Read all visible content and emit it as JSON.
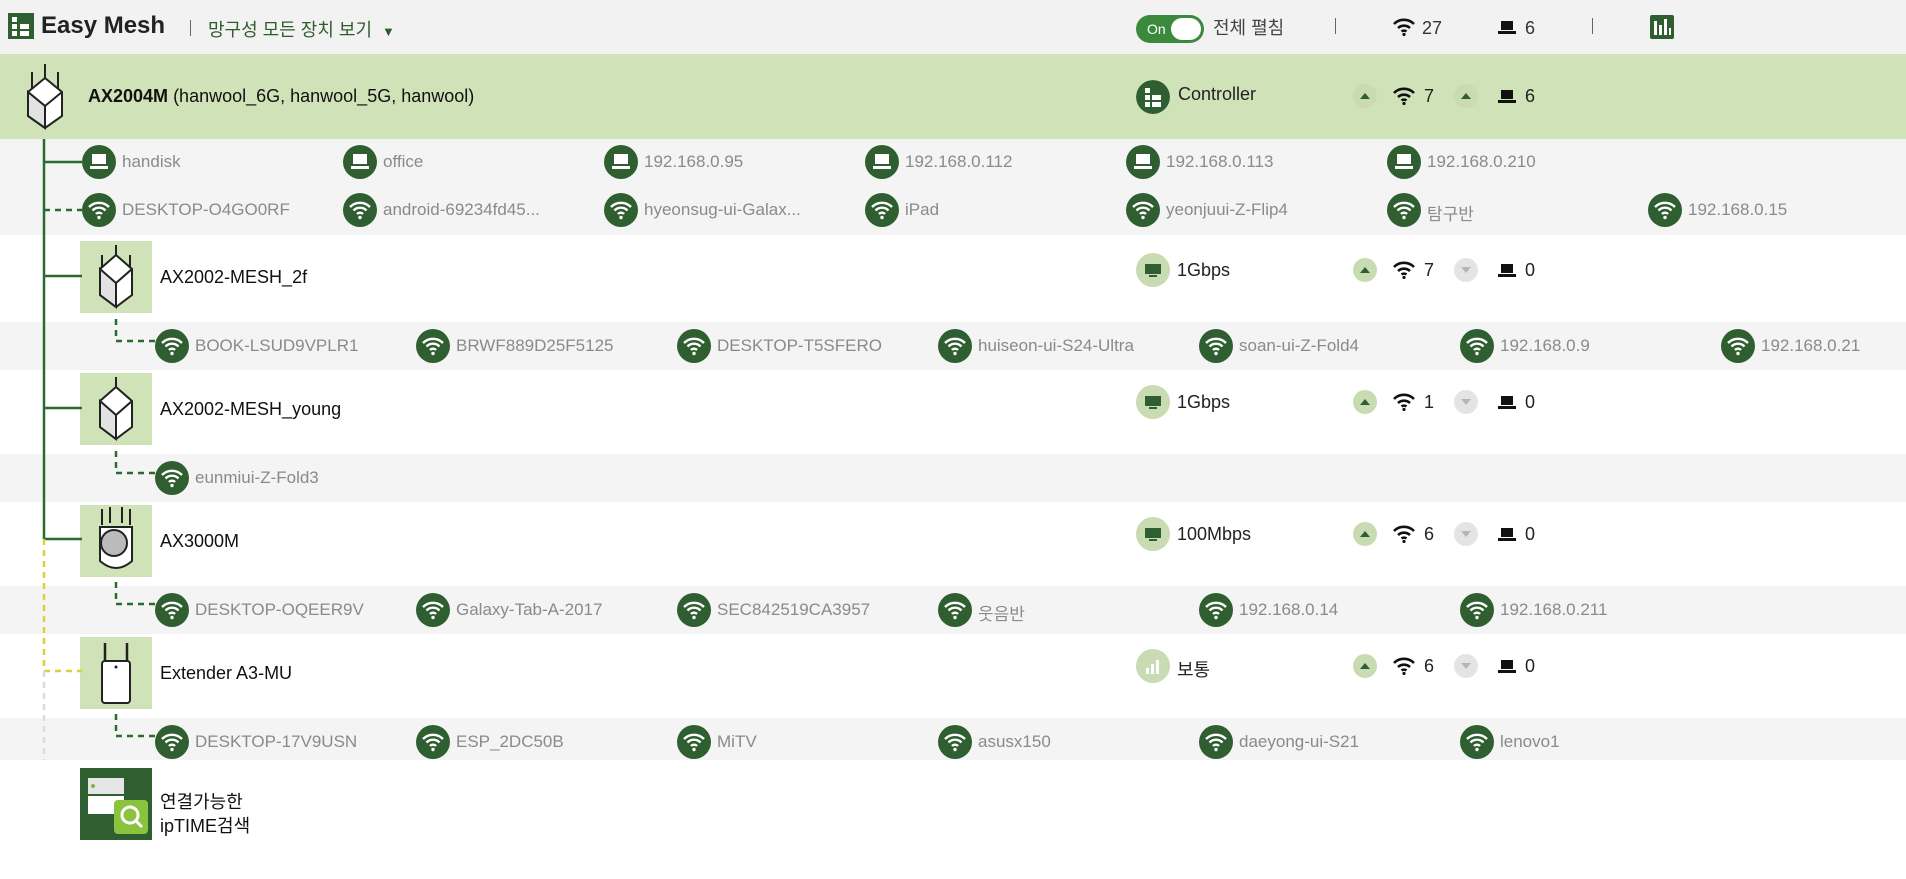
{
  "header": {
    "app_title": "Easy Mesh",
    "view_select": "망구성 모든 장치 보기",
    "toggle_label": "On",
    "expand_label": "전체 펼침",
    "wifi_total": "27",
    "wired_total": "6"
  },
  "main_router": {
    "model": "AX2004M",
    "ssids": "(hanwool_6G, hanwool_5G, hanwool)",
    "role": "Controller",
    "wifi_count": "7",
    "wired_count": "6",
    "wired_clients": [
      "handisk",
      "office",
      "192.168.0.95",
      "192.168.0.112",
      "192.168.0.113",
      "192.168.0.210"
    ],
    "wifi_clients": [
      "DESKTOP-O4GO0RF",
      "android-69234fd45...",
      "hyeonsug-ui-Galax...",
      "iPad",
      "yeonjuui-Z-Flip4",
      "탐구반",
      "192.168.0.15"
    ]
  },
  "agents": [
    {
      "name": "AX2002-MESH_2f",
      "link": "1Gbps",
      "wifi_count": "7",
      "wired_count": "0",
      "clients": [
        "BOOK-LSUD9VPLR1",
        "BRWF889D25F5125",
        "DESKTOP-T5SFERO",
        "huiseon-ui-S24-Ultra",
        "soan-ui-Z-Fold4",
        "192.168.0.9",
        "192.168.0.21"
      ]
    },
    {
      "name": "AX2002-MESH_young",
      "link": "1Gbps",
      "wifi_count": "1",
      "wired_count": "0",
      "clients": [
        "eunmiui-Z-Fold3"
      ]
    },
    {
      "name": "AX3000M",
      "link": "100Mbps",
      "wifi_count": "6",
      "wired_count": "0",
      "clients": [
        "DESKTOP-OQEER9V",
        "Galaxy-Tab-A-2017",
        "SEC842519CA3957",
        "웃음반",
        "192.168.0.14",
        "192.168.0.211"
      ]
    },
    {
      "name": "Extender A3-MU",
      "link": "보통",
      "wifi_count": "6",
      "wired_count": "0",
      "clients": [
        "DESKTOP-17V9USN",
        "ESP_2DC50B",
        "MiTV",
        "asusx150",
        "daeyong-ui-S21",
        "lenovo1"
      ]
    }
  ],
  "search": {
    "line1": "연결가능한",
    "line2": "ipTIME검색"
  },
  "colors": {
    "accent_green": "#2f5e30",
    "main_row_bg": "#cfe2b8",
    "wired_line": "#2d6b2d",
    "extender_line": "#d7d23a",
    "search_line": "#dcdcdc"
  }
}
